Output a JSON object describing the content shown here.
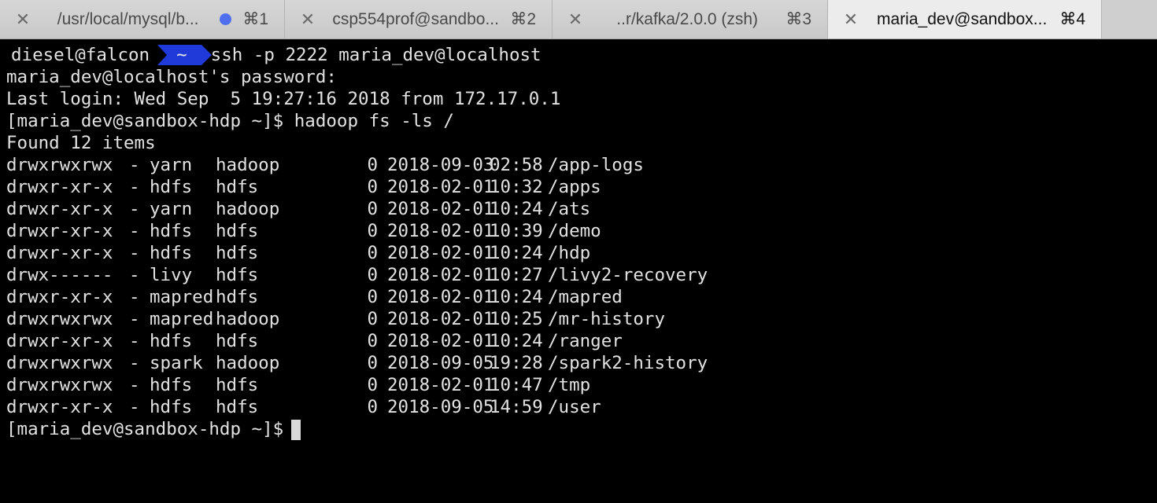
{
  "tabs": [
    {
      "title": "/usr/local/mysql/b...",
      "shortcut": "⌘1",
      "active": false,
      "has_dot": true
    },
    {
      "title": "csp554prof@sandbo...",
      "shortcut": "⌘2",
      "active": false,
      "has_dot": false
    },
    {
      "title": "..r/kafka/2.0.0 (zsh)",
      "shortcut": "⌘3",
      "active": false,
      "has_dot": false
    },
    {
      "title": "maria_dev@sandbox...",
      "shortcut": "⌘4",
      "active": true,
      "has_dot": false
    }
  ],
  "prompt": {
    "host": "diesel@falcon",
    "dir": "~",
    "command": "ssh -p 2222 maria_dev@localhost"
  },
  "lines": {
    "password": "maria_dev@localhost's password:",
    "last_login": "Last login: Wed Sep  5 19:27:16 2018 from 172.17.0.1",
    "cmd": "[maria_dev@sandbox-hdp ~]$ hadoop fs -ls /",
    "found": "Found 12 items"
  },
  "listing": [
    {
      "perm": "drwxrwxrwx",
      "repl": "-",
      "owner": "yarn",
      "group": "hadoop",
      "size": "0",
      "date": "2018-09-03",
      "time": "02:58",
      "path": "/app-logs"
    },
    {
      "perm": "drwxr-xr-x",
      "repl": "-",
      "owner": "hdfs",
      "group": "hdfs",
      "size": "0",
      "date": "2018-02-01",
      "time": "10:32",
      "path": "/apps"
    },
    {
      "perm": "drwxr-xr-x",
      "repl": "-",
      "owner": "yarn",
      "group": "hadoop",
      "size": "0",
      "date": "2018-02-01",
      "time": "10:24",
      "path": "/ats"
    },
    {
      "perm": "drwxr-xr-x",
      "repl": "-",
      "owner": "hdfs",
      "group": "hdfs",
      "size": "0",
      "date": "2018-02-01",
      "time": "10:39",
      "path": "/demo"
    },
    {
      "perm": "drwxr-xr-x",
      "repl": "-",
      "owner": "hdfs",
      "group": "hdfs",
      "size": "0",
      "date": "2018-02-01",
      "time": "10:24",
      "path": "/hdp"
    },
    {
      "perm": "drwx------",
      "repl": "-",
      "owner": "livy",
      "group": "hdfs",
      "size": "0",
      "date": "2018-02-01",
      "time": "10:27",
      "path": "/livy2-recovery"
    },
    {
      "perm": "drwxr-xr-x",
      "repl": "-",
      "owner": "mapred",
      "group": "hdfs",
      "size": "0",
      "date": "2018-02-01",
      "time": "10:24",
      "path": "/mapred"
    },
    {
      "perm": "drwxrwxrwx",
      "repl": "-",
      "owner": "mapred",
      "group": "hadoop",
      "size": "0",
      "date": "2018-02-01",
      "time": "10:25",
      "path": "/mr-history"
    },
    {
      "perm": "drwxr-xr-x",
      "repl": "-",
      "owner": "hdfs",
      "group": "hdfs",
      "size": "0",
      "date": "2018-02-01",
      "time": "10:24",
      "path": "/ranger"
    },
    {
      "perm": "drwxrwxrwx",
      "repl": "-",
      "owner": "spark",
      "group": "hadoop",
      "size": "0",
      "date": "2018-09-05",
      "time": "19:28",
      "path": "/spark2-history"
    },
    {
      "perm": "drwxrwxrwx",
      "repl": "-",
      "owner": "hdfs",
      "group": "hdfs",
      "size": "0",
      "date": "2018-02-01",
      "time": "10:47",
      "path": "/tmp"
    },
    {
      "perm": "drwxr-xr-x",
      "repl": "-",
      "owner": "hdfs",
      "group": "hdfs",
      "size": "0",
      "date": "2018-09-05",
      "time": "14:59",
      "path": "/user"
    }
  ],
  "final_prompt": "[maria_dev@sandbox-hdp ~]$",
  "colors": {
    "prompt_badge": "#1f3ad8",
    "tab_dot": "#4f6ff0"
  }
}
